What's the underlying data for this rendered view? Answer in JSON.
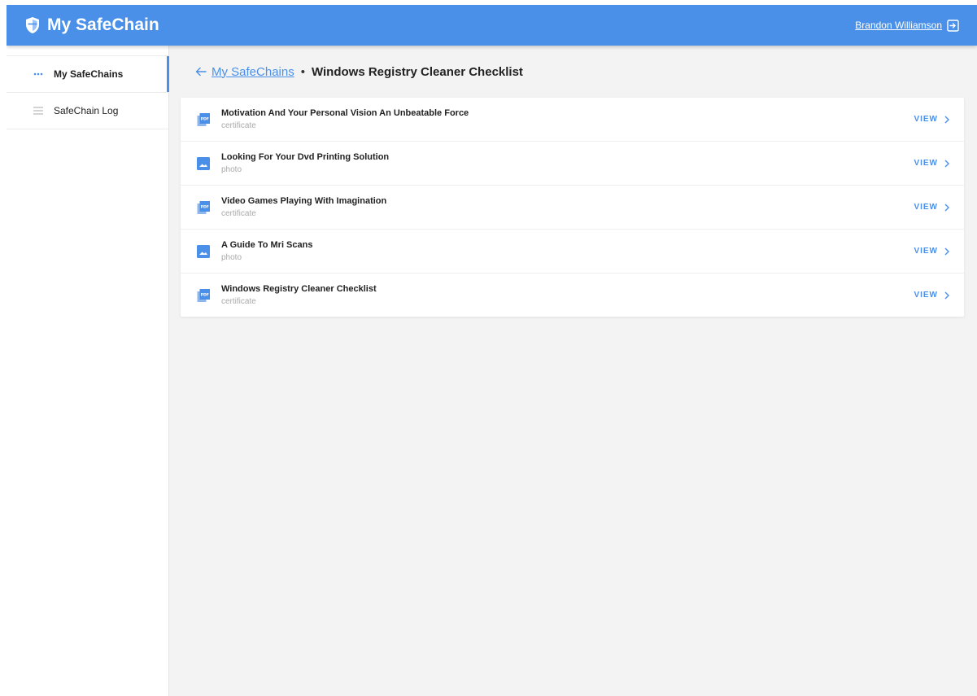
{
  "app": {
    "brand": "My SafeChain",
    "user_name": "Brandon Williamson",
    "accent": "#4a90e9"
  },
  "sidebar": {
    "items": [
      {
        "label": "My SafeChains",
        "icon": "ellipsis-icon",
        "active": true
      },
      {
        "label": "SafeChain Log",
        "icon": "list-icon",
        "active": false
      }
    ]
  },
  "breadcrumb": {
    "back_label": "My SafeChains",
    "separator": "•",
    "current": "Windows Registry Cleaner Checklist"
  },
  "files": [
    {
      "title": "Motivation And Your Personal Vision An Unbeatable Force",
      "type": "certificate",
      "icon": "pdf-icon",
      "action": "VIEW"
    },
    {
      "title": "Looking For Your Dvd Printing Solution",
      "type": "photo",
      "icon": "image-icon",
      "action": "VIEW"
    },
    {
      "title": "Video Games Playing With Imagination",
      "type": "certificate",
      "icon": "pdf-icon",
      "action": "VIEW"
    },
    {
      "title": "A Guide To Mri Scans",
      "type": "photo",
      "icon": "image-icon",
      "action": "VIEW"
    },
    {
      "title": "Windows Registry Cleaner Checklist",
      "type": "certificate",
      "icon": "pdf-icon",
      "action": "VIEW"
    }
  ]
}
